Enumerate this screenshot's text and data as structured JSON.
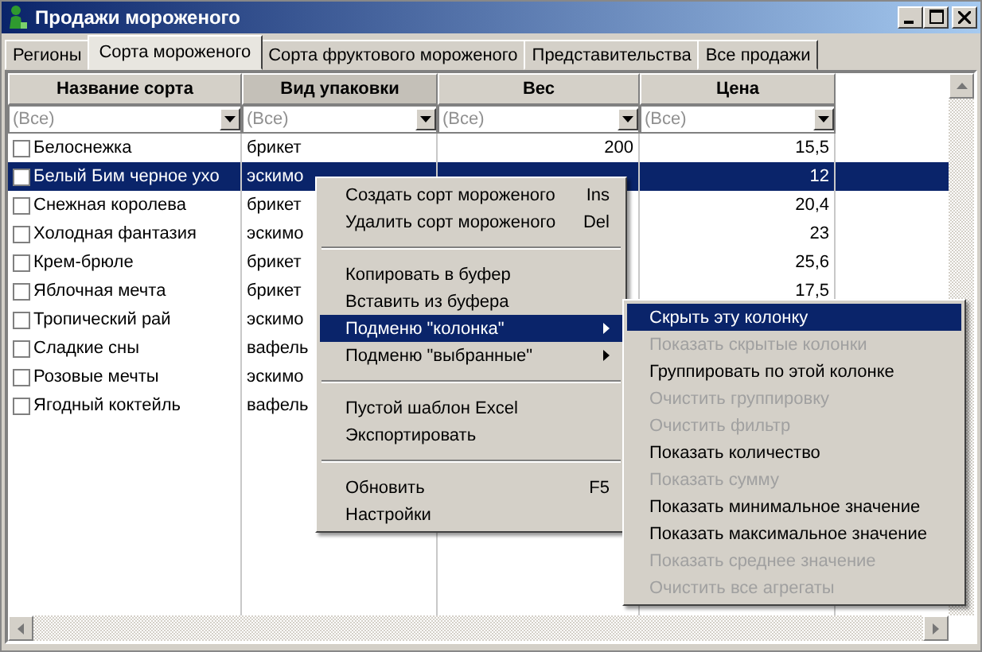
{
  "window": {
    "title": "Продажи мороженого"
  },
  "tabs": [
    {
      "label": "Регионы",
      "selected": false
    },
    {
      "label": "Сорта мороженого",
      "selected": true
    },
    {
      "label": "Сорта фруктового мороженого",
      "selected": false
    },
    {
      "label": "Представительства",
      "selected": false
    },
    {
      "label": "Все продажи",
      "selected": false
    }
  ],
  "table": {
    "columns": [
      {
        "label": "Название сорта",
        "selected": false,
        "filter": "(Все)",
        "kind": "text"
      },
      {
        "label": "Вид упаковки",
        "selected": true,
        "filter": "(Все)",
        "kind": "text"
      },
      {
        "label": "Вес",
        "selected": false,
        "filter": "(Все)",
        "kind": "number"
      },
      {
        "label": "Цена",
        "selected": false,
        "filter": "(Все)",
        "kind": "number"
      }
    ],
    "rows": [
      {
        "checked": false,
        "selected": false,
        "cells": [
          "Белоснежка",
          "брикет",
          "200",
          "15,5"
        ]
      },
      {
        "checked": false,
        "selected": true,
        "cells": [
          "Белый Бим черное ухо",
          "эскимо",
          "",
          "12"
        ]
      },
      {
        "checked": false,
        "selected": false,
        "cells": [
          "Снежная королева",
          "брикет",
          "",
          "20,4"
        ]
      },
      {
        "checked": false,
        "selected": false,
        "cells": [
          "Холодная фантазия",
          "эскимо",
          "",
          "23"
        ]
      },
      {
        "checked": false,
        "selected": false,
        "cells": [
          "Крем-брюле",
          "брикет",
          "",
          "25,6"
        ]
      },
      {
        "checked": false,
        "selected": false,
        "cells": [
          "Яблочная мечта",
          "брикет",
          "",
          "17,5"
        ]
      },
      {
        "checked": false,
        "selected": false,
        "cells": [
          "Тропический рай",
          "эскимо",
          "",
          ""
        ]
      },
      {
        "checked": false,
        "selected": false,
        "cells": [
          "Сладкие сны",
          "вафель",
          "",
          ""
        ]
      },
      {
        "checked": false,
        "selected": false,
        "cells": [
          "Розовые мечты",
          "эскимо",
          "",
          ""
        ]
      },
      {
        "checked": false,
        "selected": false,
        "cells": [
          "Ягодный коктейль",
          "вафель",
          "",
          ""
        ]
      }
    ]
  },
  "context_menu": {
    "items": [
      {
        "kind": "item",
        "label": "Создать сорт мороженого",
        "shortcut": "Ins",
        "selected": false,
        "submenu": false
      },
      {
        "kind": "item",
        "label": "Удалить сорт мороженого",
        "shortcut": "Del",
        "selected": false,
        "submenu": false
      },
      {
        "kind": "separator"
      },
      {
        "kind": "item",
        "label": "Копировать в буфер",
        "selected": false,
        "submenu": false
      },
      {
        "kind": "item",
        "label": "Вставить из буфера",
        "selected": false,
        "submenu": false
      },
      {
        "kind": "item",
        "label": "Подменю \"колонка\"",
        "selected": true,
        "submenu": true
      },
      {
        "kind": "item",
        "label": "Подменю \"выбранные\"",
        "selected": false,
        "submenu": true
      },
      {
        "kind": "separator"
      },
      {
        "kind": "item",
        "label": "Пустой шаблон Excel",
        "selected": false,
        "submenu": false
      },
      {
        "kind": "item",
        "label": "Экспортировать",
        "selected": false,
        "submenu": false
      },
      {
        "kind": "separator"
      },
      {
        "kind": "item",
        "label": "Обновить",
        "shortcut": "F5",
        "selected": false,
        "submenu": false
      },
      {
        "kind": "item",
        "label": "Настройки",
        "selected": false,
        "submenu": false
      }
    ]
  },
  "submenu": {
    "items": [
      {
        "label": "Скрыть эту колонку",
        "selected": true,
        "disabled": false
      },
      {
        "label": "Показать скрытые колонки",
        "selected": false,
        "disabled": true
      },
      {
        "label": "Группировать по этой колонке",
        "selected": false,
        "disabled": false
      },
      {
        "label": "Очистить группировку",
        "selected": false,
        "disabled": true
      },
      {
        "label": "Очистить фильтр",
        "selected": false,
        "disabled": true
      },
      {
        "label": "Показать количество",
        "selected": false,
        "disabled": false
      },
      {
        "label": "Показать сумму",
        "selected": false,
        "disabled": true
      },
      {
        "label": "Показать минимальное значение",
        "selected": false,
        "disabled": false
      },
      {
        "label": "Показать максимальное значение",
        "selected": false,
        "disabled": false
      },
      {
        "label": "Показать среднее значение",
        "selected": false,
        "disabled": true
      },
      {
        "label": "Очистить все агрегаты",
        "selected": false,
        "disabled": true
      }
    ]
  }
}
